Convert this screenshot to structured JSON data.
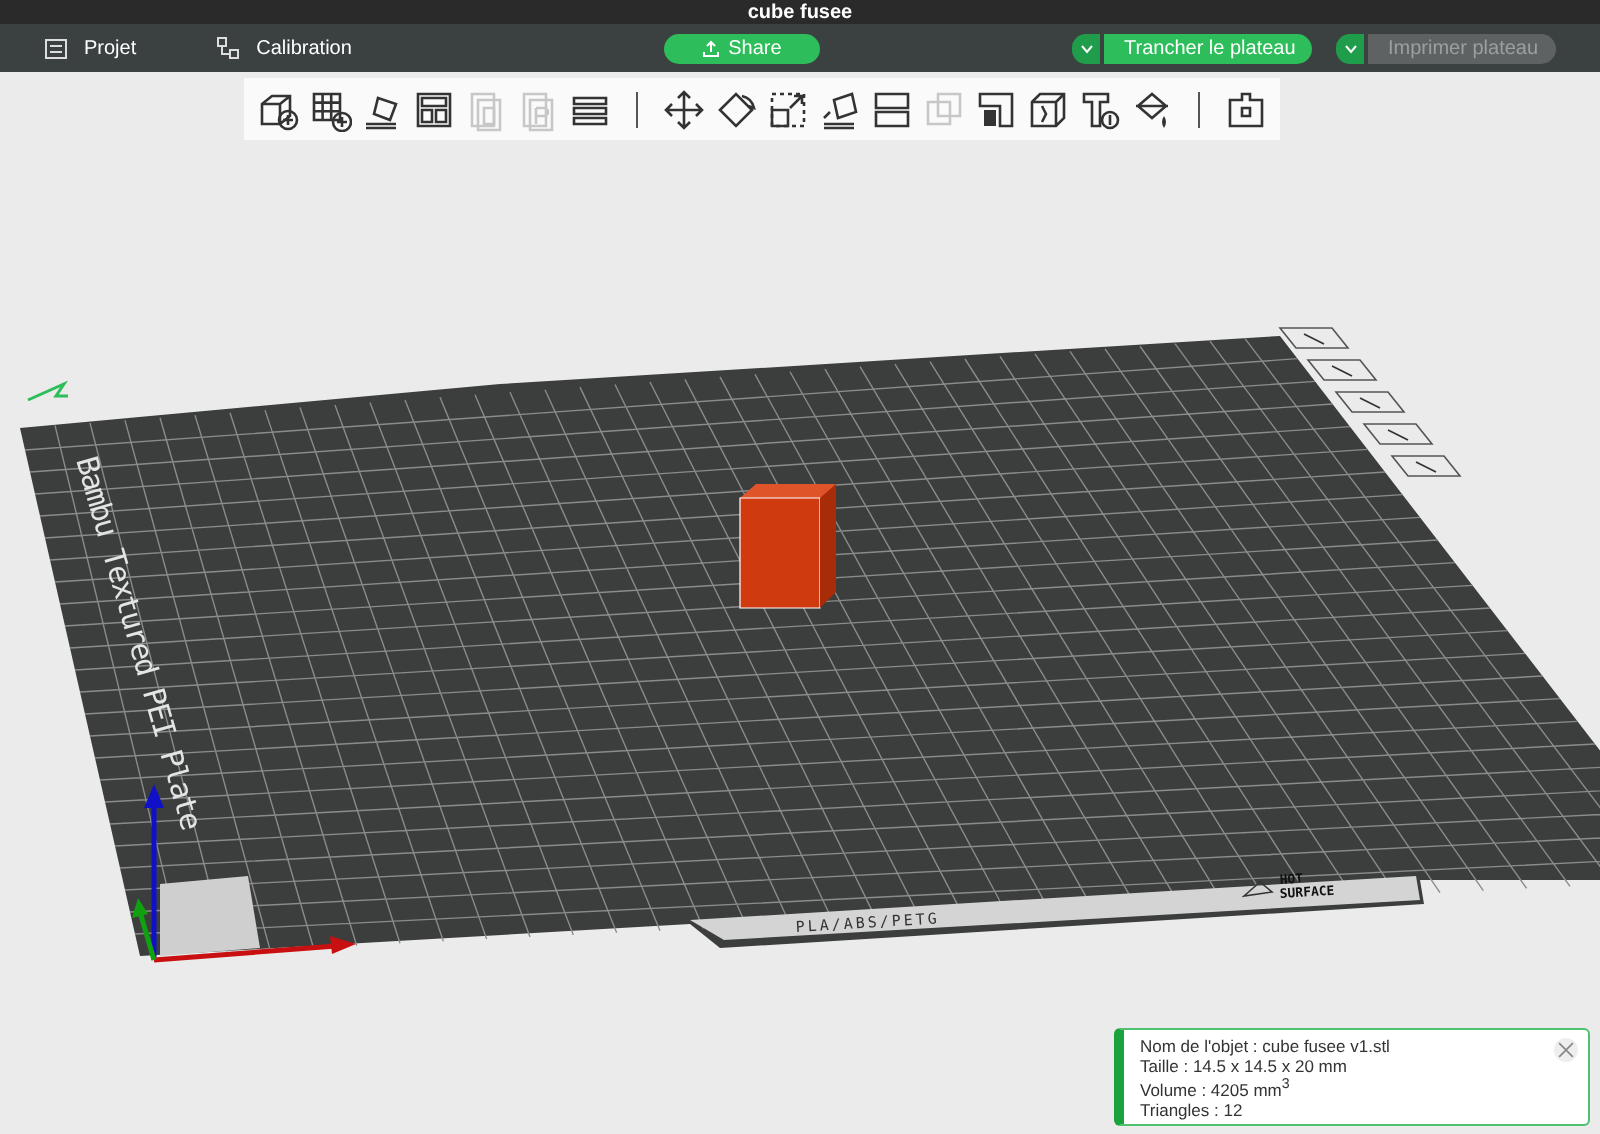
{
  "window": {
    "title": "cube fusee"
  },
  "nav": {
    "items": [
      {
        "label": "Projet",
        "kind": "project"
      },
      {
        "label": "Calibration",
        "kind": "calibration"
      }
    ]
  },
  "actions": {
    "share": {
      "label": "Share"
    },
    "slice": {
      "label": "Trancher le plateau",
      "disabled": false
    },
    "print": {
      "label": "Imprimer plateau",
      "disabled": true
    }
  },
  "toolbar": {
    "groups": [
      [
        {
          "disabled": false
        },
        {
          "disabled": false
        },
        {
          "disabled": false
        },
        {
          "disabled": false
        },
        {
          "disabled": true
        },
        {
          "disabled": true
        },
        {
          "disabled": false
        }
      ],
      [
        {
          "disabled": false
        },
        {
          "disabled": false
        },
        {
          "disabled": false
        },
        {
          "disabled": false
        },
        {
          "disabled": false
        },
        {
          "disabled": true
        },
        {
          "disabled": false
        },
        {
          "disabled": false
        },
        {
          "disabled": false
        },
        {
          "disabled": false
        }
      ],
      [
        {
          "disabled": false
        }
      ]
    ]
  },
  "plate": {
    "name": "Bambu Textured PEI Plate",
    "material": "PLA/ABS/PETG",
    "warning_1": "HOT",
    "warning_2": "SURFACE"
  },
  "object_info": {
    "lines": [
      "Nom de l'objet : cube fusee v1.stl",
      "Taille : 14.5 x 14.5 x 20 mm",
      "Volume : 4205 mm$^{3}$",
      "Triangles : 12"
    ]
  }
}
